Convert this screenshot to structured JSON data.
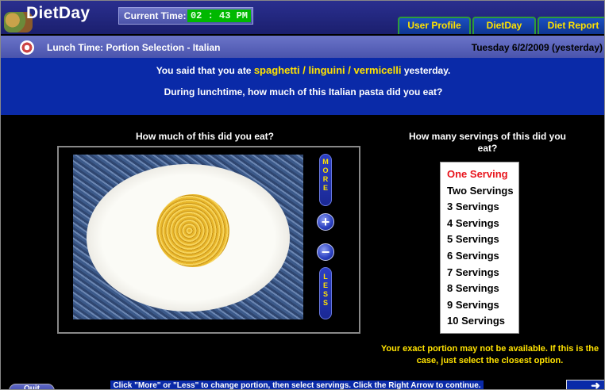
{
  "app": {
    "title": "DietDay",
    "current_time_label": "Current Time:",
    "current_time": "02 : 43  PM"
  },
  "tabs": [
    {
      "label": "User Profile"
    },
    {
      "label": "DietDay"
    },
    {
      "label": "Diet Report"
    }
  ],
  "section": {
    "title": "Lunch Time: Portion Selection - Italian",
    "date": "Tuesday 6/2/2009 (yesterday)"
  },
  "question": {
    "line1_prefix": "You said that you ate",
    "food": "spaghetti / linguini / vermicelli",
    "line1_suffix": "yesterday.",
    "line2": "During lunchtime, how much of this Italian pasta did you eat?"
  },
  "portion": {
    "heading": "How much of this did you eat?",
    "more_label": "M O R E",
    "less_label": "L E S S",
    "plus_symbol": "+",
    "minus_symbol": "−"
  },
  "servings": {
    "heading": "How many servings of this did you eat?",
    "selected_index": 0,
    "options": [
      "One Serving",
      "Two Servings",
      "3 Servings",
      "4 Servings",
      "5 Servings",
      "6 Servings",
      "7 Servings",
      "8 Servings",
      "9 Servings",
      "10 Servings"
    ],
    "note": "Your exact portion may not be available.  If this is the case, just select the closest option."
  },
  "footer": {
    "quit_label": "Quit",
    "instructions": "Click \"More\" or \"Less\" to change portion, then select servings. Click the Right Arrow to continue."
  },
  "icons": {
    "section_icon": "plate-icon",
    "logo": "fruit-basket-icon",
    "next": "right-arrow-icon"
  },
  "colors": {
    "selected_serving": "#e8141c",
    "highlight_text": "#ffe200",
    "time_display": "#00b800",
    "question_bg": "#0a2aa8"
  }
}
